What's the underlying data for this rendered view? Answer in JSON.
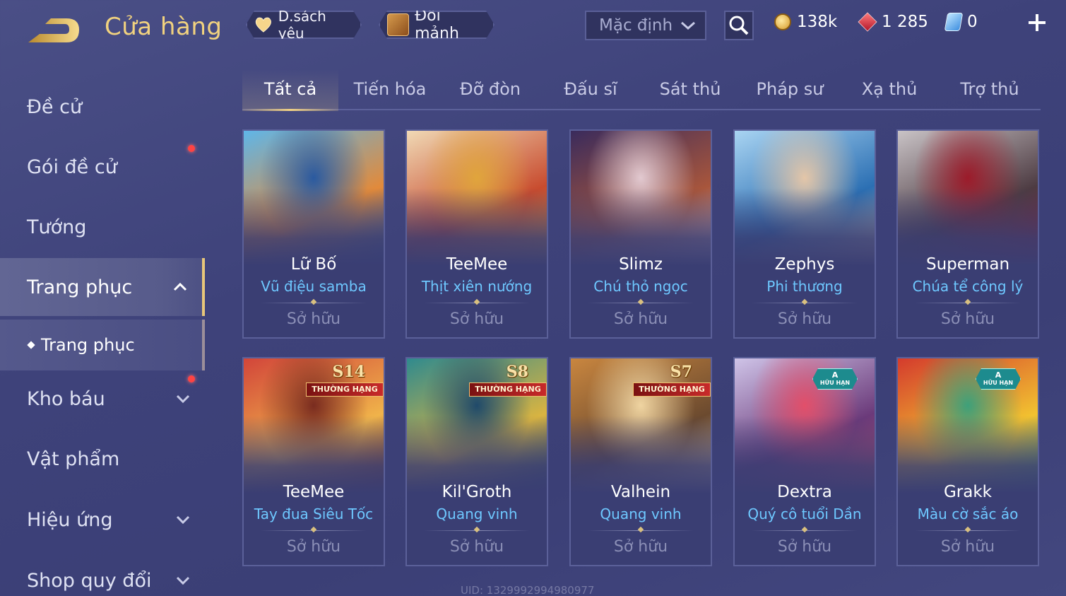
{
  "header": {
    "title": "Cửa hàng",
    "favorites_label": "D.sách yêu",
    "exchange_label": "Đổi mảnh",
    "sort_value": "Mặc định",
    "currencies": {
      "gold": "138k",
      "gems": "1 285",
      "vouchers": "0"
    }
  },
  "sidebar": {
    "items": [
      {
        "label": "Đề cử"
      },
      {
        "label": "Gói đề cử"
      },
      {
        "label": "Tướng"
      },
      {
        "label": "Trang phục"
      },
      {
        "label": "Kho báu"
      },
      {
        "label": "Vật phẩm"
      },
      {
        "label": "Hiệu ứng"
      },
      {
        "label": "Shop quy đổi"
      }
    ],
    "sub_item": "Trang phục"
  },
  "tabs": [
    "Tất cả",
    "Tiến hóa",
    "Đỡ đòn",
    "Đấu sĩ",
    "Sát thủ",
    "Pháp sư",
    "Xạ thủ",
    "Trợ thủ"
  ],
  "active_tab": "Tất cả",
  "cards": [
    {
      "hero": "Lữ Bố",
      "skin": "Vũ điệu samba",
      "status": "Sở hữu",
      "art_colors": [
        "#5fb6e8",
        "#e28a3a",
        "#2a5aa0"
      ]
    },
    {
      "hero": "TeeMee",
      "skin": "Thịt xiên nướng",
      "status": "Sở hữu",
      "art_colors": [
        "#f0d9b5",
        "#c84b2e",
        "#e0a53c"
      ]
    },
    {
      "hero": "Slimz",
      "skin": "Chú thỏ ngọc",
      "status": "Sở hữu",
      "art_colors": [
        "#3a2b5c",
        "#a8563c",
        "#e2c9d0"
      ]
    },
    {
      "hero": "Zephys",
      "skin": "Phi thương",
      "status": "Sở hữu",
      "art_colors": [
        "#a9d4f2",
        "#2b6fb3",
        "#e4c6a8"
      ]
    },
    {
      "hero": "Superman",
      "skin": "Chúa tể công lý",
      "status": "Sở hữu",
      "art_colors": [
        "#c9c3c6",
        "#4d3b42",
        "#9c1b2a"
      ]
    },
    {
      "hero": "TeeMee",
      "skin": "Tay đua Siêu Tốc",
      "status": "Sở hữu",
      "badge": "S14",
      "badge_text": "THƯỜNG HẠNG",
      "art_colors": [
        "#d2453a",
        "#f0b34a",
        "#7a2c1f"
      ]
    },
    {
      "hero": "Kil'Groth",
      "skin": "Quang vinh",
      "status": "Sở hữu",
      "badge": "S8",
      "badge_text": "THƯỜNG HẠNG",
      "art_colors": [
        "#2f8a8e",
        "#d9b441",
        "#204a6a"
      ]
    },
    {
      "hero": "Valhein",
      "skin": "Quang vinh",
      "status": "Sở hữu",
      "badge": "S7",
      "badge_text": "THƯỜNG HẠNG",
      "art_colors": [
        "#c9863f",
        "#6b4a2f",
        "#efd4a1"
      ]
    },
    {
      "hero": "Dextra",
      "skin": "Quý cô tuổi Dần",
      "status": "Sở hữu",
      "limited": "A",
      "limited_text": "HỮU HẠN",
      "art_colors": [
        "#cfc4e8",
        "#6b3a7a",
        "#e24f6a"
      ]
    },
    {
      "hero": "Grakk",
      "skin": "Màu cờ sắc áo",
      "status": "Sở hữu",
      "limited": "A",
      "limited_text": "HỮU HẠN",
      "art_colors": [
        "#d43b2d",
        "#f2c230",
        "#3ea07a"
      ]
    }
  ],
  "footer": {
    "uid": "UID: 1329992994980977"
  }
}
